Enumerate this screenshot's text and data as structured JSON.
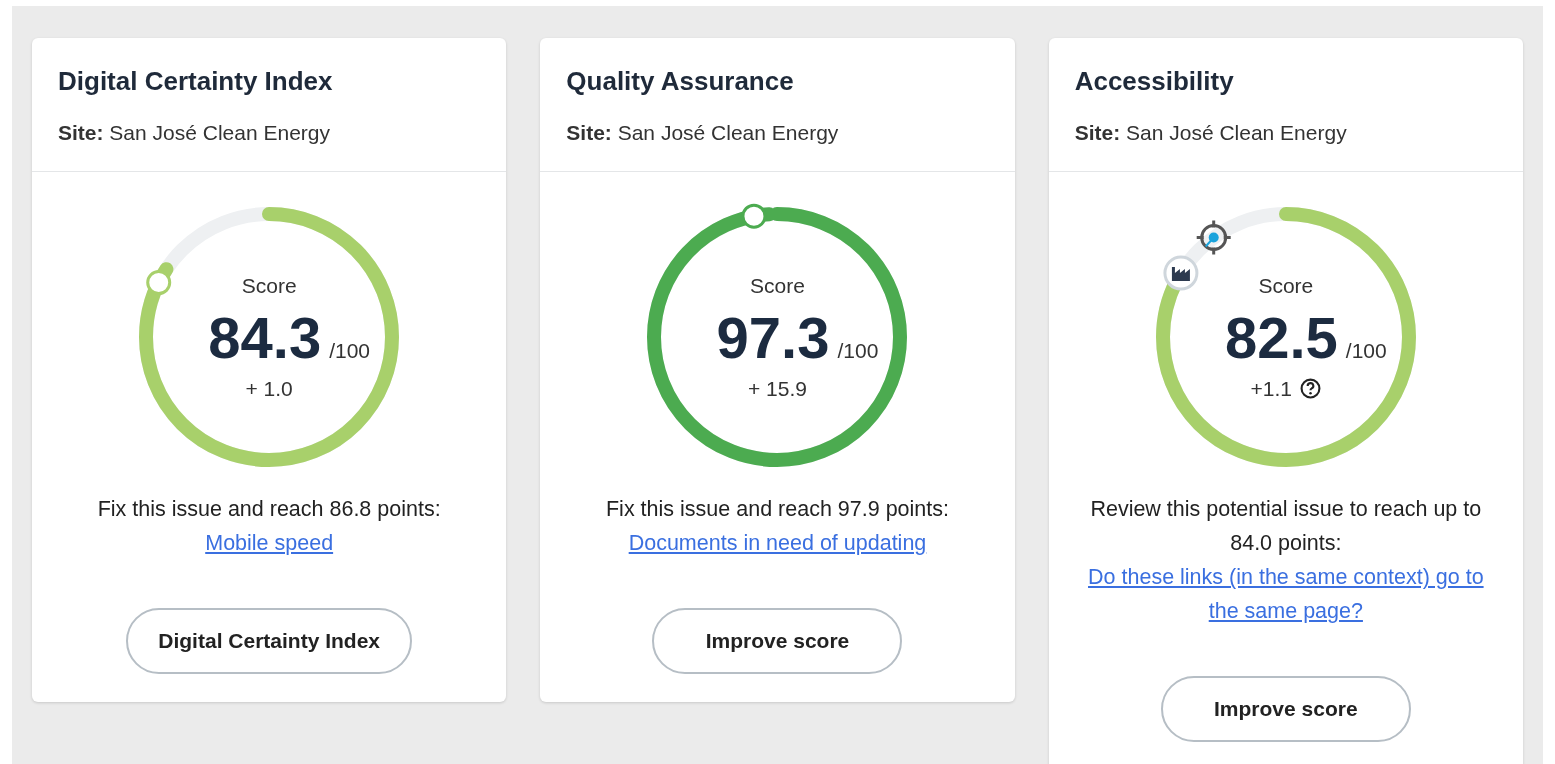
{
  "cards": [
    {
      "title": "Digital Certainty Index",
      "site_label": "Site:",
      "site": "San José Clean Energy",
      "gauge": {
        "label": "Score",
        "score": "84.3",
        "max": "/100",
        "delta": "+ 1.0",
        "level": 0.843,
        "color": "#a8d06b",
        "markers": [
          {
            "kind": "dot"
          }
        ]
      },
      "note": "Fix this issue and reach 86.8 points: ",
      "link": "Mobile speed",
      "button": "Digital Certainty Index"
    },
    {
      "title": "Quality Assurance",
      "site_label": "Site:",
      "site": "San José Clean Energy",
      "gauge": {
        "label": "Score",
        "score": "97.3",
        "max": "/100",
        "delta": "+ 15.9",
        "level": 0.99,
        "color": "#4cab50",
        "markers": [
          {
            "kind": "dot"
          }
        ]
      },
      "note": "Fix this issue and reach 97.9 points: ",
      "link": "Documents in need of updating",
      "button": "Improve score"
    },
    {
      "title": "Accessibility",
      "site_label": "Site:",
      "site": "San José Clean Energy",
      "gauge": {
        "label": "Score",
        "score": "82.5",
        "max": "/100",
        "delta": "+1.1",
        "help": true,
        "level": 0.825,
        "color": "#a8d06b",
        "markers": [
          {
            "kind": "factory"
          },
          {
            "kind": "target"
          }
        ]
      },
      "note": "Review this potential issue to reach up to 84.0 points: ",
      "link": "Do these links (in the same context) go to the same page?",
      "button": "Improve score"
    }
  ]
}
